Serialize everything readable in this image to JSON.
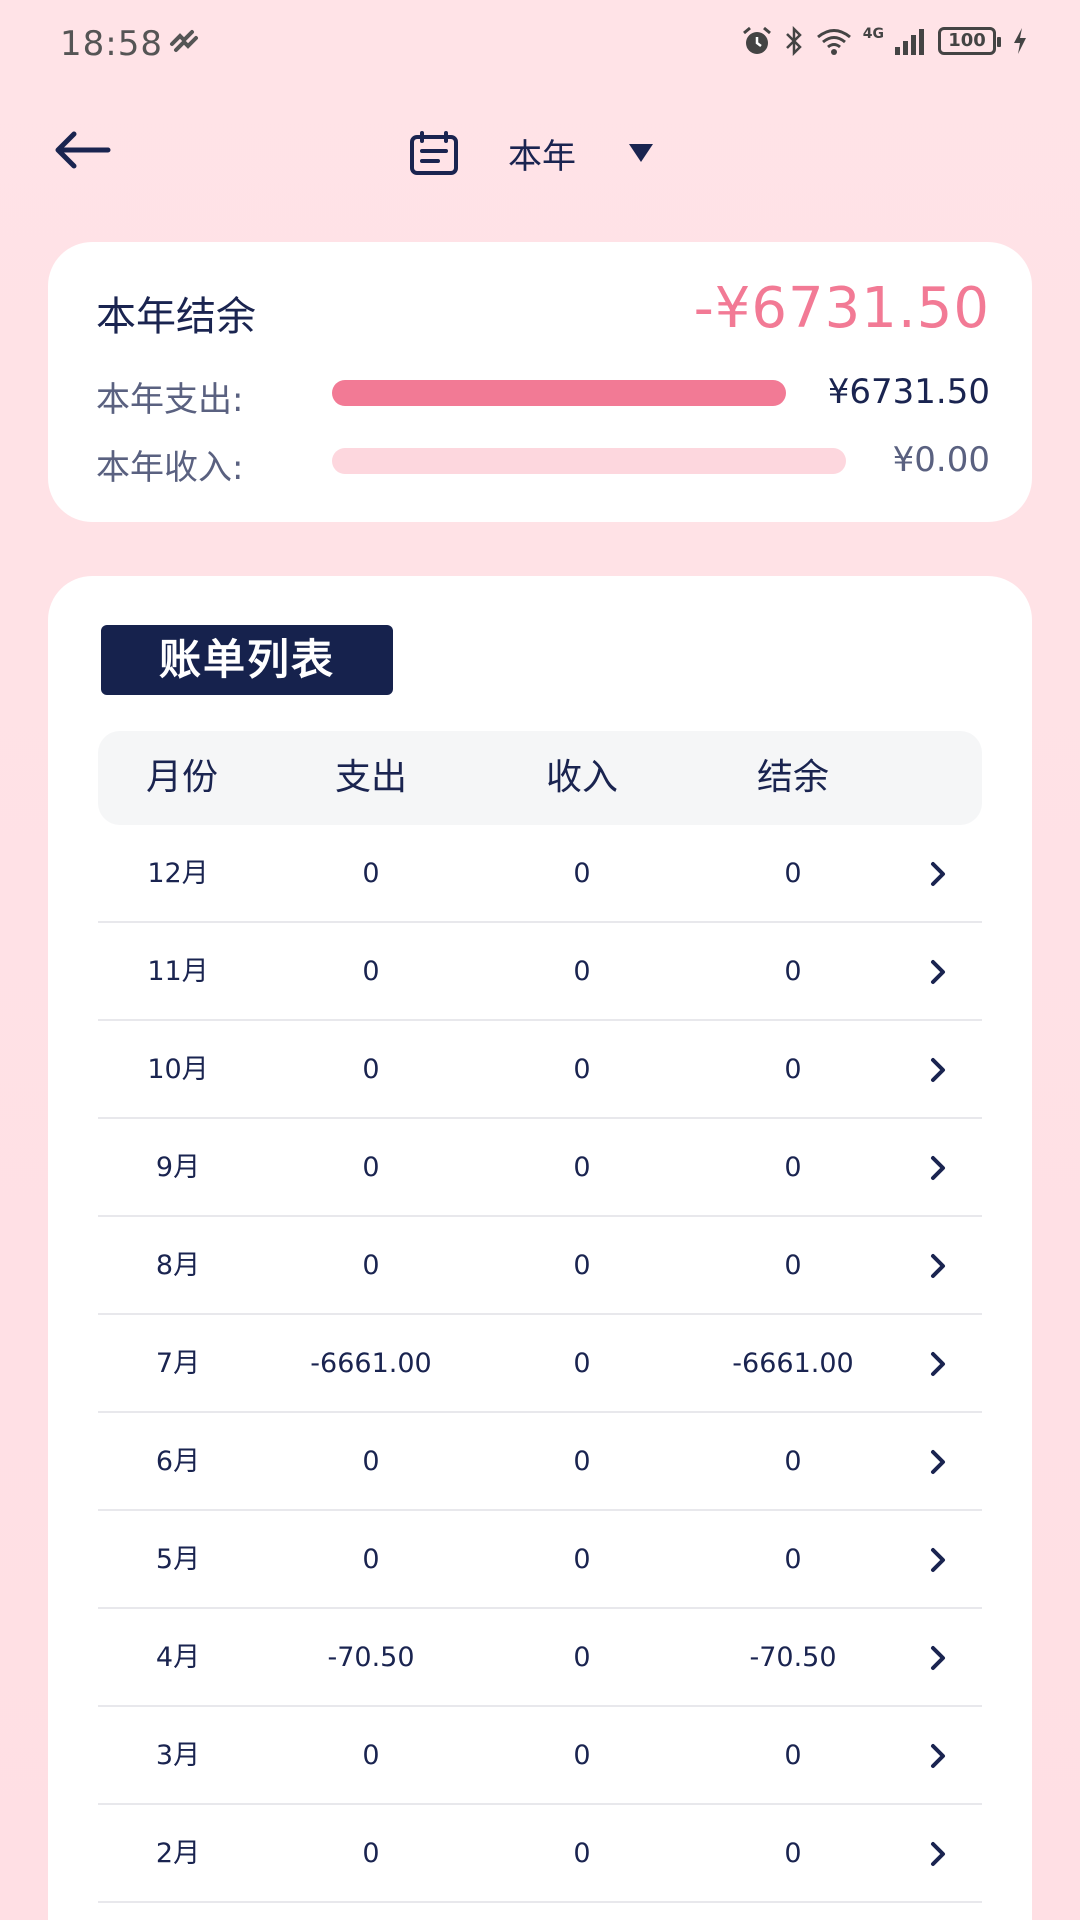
{
  "status_bar": {
    "time": "18:58",
    "battery": "100",
    "network": "4G"
  },
  "header": {
    "period_label": "本年"
  },
  "summary": {
    "title": "本年结余",
    "balance": "-¥6731.50",
    "expense_label": "本年支出:",
    "expense_value": "¥6731.50",
    "expense_fill": 1.0,
    "income_label": "本年收入:",
    "income_value": "¥0.00",
    "income_fill": 0.0
  },
  "bill_list": {
    "title": "账单列表",
    "headers": [
      "月份",
      "支出",
      "收入",
      "结余"
    ],
    "rows": [
      {
        "month": "12月",
        "expense": "0",
        "income": "0",
        "balance": "0"
      },
      {
        "month": "11月",
        "expense": "0",
        "income": "0",
        "balance": "0"
      },
      {
        "month": "10月",
        "expense": "0",
        "income": "0",
        "balance": "0"
      },
      {
        "month": "9月",
        "expense": "0",
        "income": "0",
        "balance": "0"
      },
      {
        "month": "8月",
        "expense": "0",
        "income": "0",
        "balance": "0"
      },
      {
        "month": "7月",
        "expense": "-6661.00",
        "income": "0",
        "balance": "-6661.00"
      },
      {
        "month": "6月",
        "expense": "0",
        "income": "0",
        "balance": "0"
      },
      {
        "month": "5月",
        "expense": "0",
        "income": "0",
        "balance": "0"
      },
      {
        "month": "4月",
        "expense": "-70.50",
        "income": "0",
        "balance": "-70.50"
      },
      {
        "month": "3月",
        "expense": "0",
        "income": "0",
        "balance": "0"
      },
      {
        "month": "2月",
        "expense": "0",
        "income": "0",
        "balance": "0"
      }
    ]
  },
  "colors": {
    "accent": "#f27a95",
    "accent_light": "#fdd7de",
    "navy": "#16224d",
    "background": "#ffe0e5"
  },
  "icons": [
    "back-arrow-icon",
    "calendar-icon",
    "dropdown-triangle-icon",
    "chevron-right-icon",
    "alarm-icon",
    "bluetooth-icon",
    "wifi-icon",
    "signal-icon",
    "battery-icon",
    "charging-icon"
  ]
}
